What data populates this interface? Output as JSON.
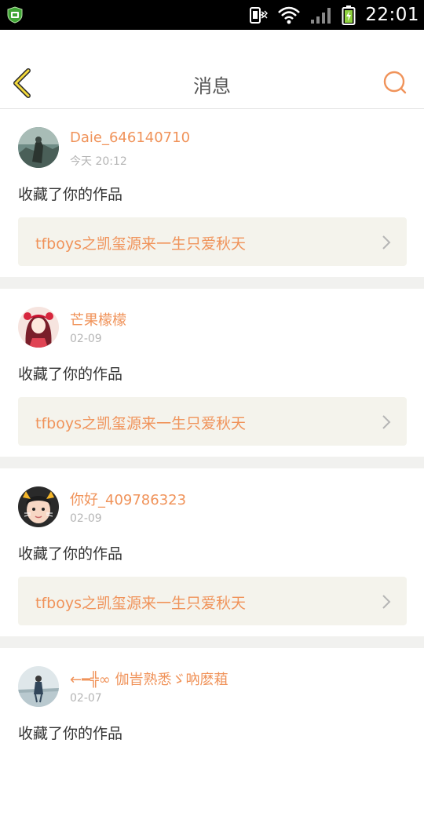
{
  "status_bar": {
    "time": "22:01",
    "icons": [
      "app-shield-icon",
      "phone-vibrate-icon",
      "wifi-icon",
      "signal-icon",
      "battery-charging-icon"
    ]
  },
  "header": {
    "title": "消息",
    "back_icon": "chevron-left-icon",
    "search_icon": "search-icon",
    "accent_color": "#f0935a"
  },
  "feed": {
    "items": [
      {
        "username": "Daie_646140710",
        "timestamp": "今天 20:12",
        "action": "收藏了你的作品",
        "work_title": "tfboys之凯玺源来一生只爱秋天"
      },
      {
        "username": "芒果檬檬",
        "timestamp": "02-09",
        "action": "收藏了你的作品",
        "work_title": "tfboys之凯玺源来一生只爱秋天"
      },
      {
        "username": "你好_409786323",
        "timestamp": "02-09",
        "action": "收藏了你的作品",
        "work_title": "tfboys之凯玺源来一生只爱秋天"
      },
      {
        "username": "←━╬∞ 伽旹熟悉ゞ吶麽蒩",
        "timestamp": "02-07",
        "action": "收藏了你的作品",
        "work_title": ""
      }
    ]
  }
}
